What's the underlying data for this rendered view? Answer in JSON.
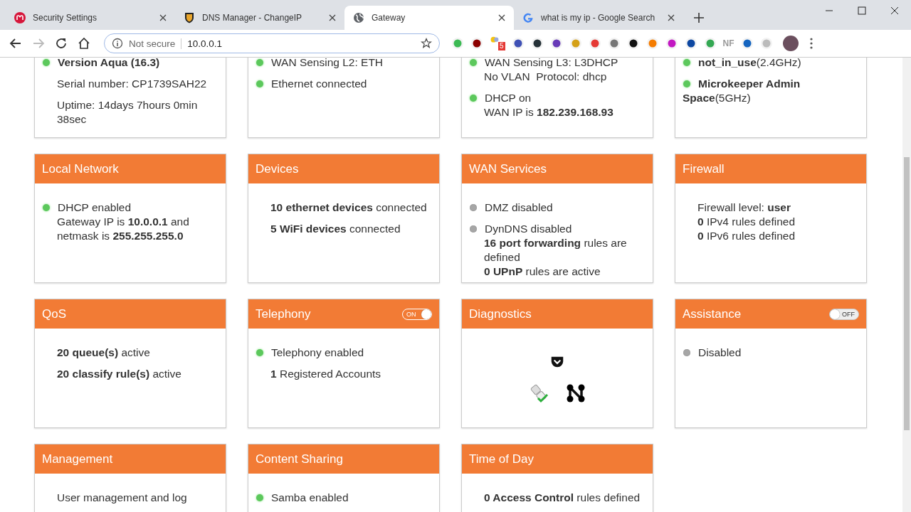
{
  "browser": {
    "tabs": [
      {
        "title": "Security Settings",
        "kind": "mlogo",
        "selected": false
      },
      {
        "title": "DNS Manager - ChangeIP",
        "kind": "shield",
        "selected": false
      },
      {
        "title": "Gateway",
        "kind": "globe",
        "selected": true
      },
      {
        "title": "what is my ip - Google Search",
        "kind": "google",
        "selected": false
      }
    ],
    "security_label": "Not secure",
    "url": "10.0.0.1",
    "extension_badge": "5",
    "extension_label": "NF"
  },
  "cards": [
    {
      "kind": "list",
      "items": [
        {
          "kind": "dot",
          "on": true,
          "bold": true,
          "lines": [
            "Version Aqua (16.3)"
          ]
        },
        {
          "kind": "plain",
          "lines": [
            "Serial number: CP1739SAH22"
          ]
        },
        {
          "kind": "plain",
          "lines": [
            "Uptime: 14days 7hours 0min 38sec"
          ]
        }
      ]
    },
    {
      "kind": "list",
      "items": [
        {
          "kind": "dot",
          "on": true,
          "lines": [
            "WAN Sensing L2: ETH"
          ]
        },
        {
          "kind": "dot",
          "on": true,
          "lines": [
            "Ethernet connected"
          ]
        }
      ]
    },
    {
      "kind": "list",
      "items": [
        {
          "kind": "dot",
          "on": true,
          "lines": [
            "WAN Sensing L3: L3DHCP",
            "No VLAN  Protocol: dhcp"
          ]
        },
        {
          "kind": "dot",
          "on": true,
          "lines": [
            "DHCP on",
            "WAN IP is **182.239.168.93**"
          ]
        }
      ]
    },
    {
      "kind": "list",
      "items": [
        {
          "kind": "dot",
          "on": true,
          "lines": [
            "**not_in_use**(2.4GHz)"
          ]
        },
        {
          "kind": "dot",
          "on": true,
          "lines": [
            "**Microkeeper Admin Space**(5GHz)"
          ]
        }
      ]
    },
    {
      "title": "Local Network",
      "kind": "list",
      "items": [
        {
          "kind": "dot",
          "on": true,
          "lines": [
            "DHCP enabled",
            "Gateway IP is **10.0.0.1** and netmask is **255.255.255.0**"
          ]
        }
      ]
    },
    {
      "title": "Devices",
      "kind": "list",
      "items": [
        {
          "kind": "plain",
          "lines": [
            "**10 ethernet devices** connected"
          ]
        },
        {
          "kind": "plain",
          "lines": [
            "**5 WiFi devices** connected"
          ]
        }
      ]
    },
    {
      "title": "WAN Services",
      "kind": "list",
      "items": [
        {
          "kind": "dot",
          "on": false,
          "lines": [
            "DMZ disabled"
          ]
        },
        {
          "kind": "dot",
          "on": false,
          "lines": [
            "DynDNS disabled",
            "**16 port forwarding** rules are defined",
            "**0 UPnP** rules are active"
          ]
        }
      ]
    },
    {
      "title": "Firewall",
      "kind": "list",
      "items": [
        {
          "kind": "plain",
          "lines": [
            "Firewall level: **user**",
            "**0** IPv4 rules defined",
            "**0** IPv6 rules defined"
          ]
        }
      ]
    },
    {
      "title": "QoS",
      "kind": "list",
      "items": [
        {
          "kind": "plain",
          "lines": [
            "**20 queue(s)** active"
          ]
        },
        {
          "kind": "plain",
          "lines": [
            "**20 classify rule(s)** active"
          ]
        }
      ]
    },
    {
      "title": "Telephony",
      "toggle": {
        "on": true,
        "label": "ON"
      },
      "kind": "list",
      "items": [
        {
          "kind": "dot",
          "on": true,
          "lines": [
            "Telephony enabled"
          ]
        },
        {
          "kind": "plain",
          "lines": [
            "**1** Registered Accounts"
          ]
        }
      ]
    },
    {
      "title": "Diagnostics",
      "kind": "icons"
    },
    {
      "title": "Assistance",
      "toggle": {
        "on": false,
        "label": "OFF"
      },
      "kind": "list",
      "items": [
        {
          "kind": "dot",
          "on": false,
          "lines": [
            "Disabled"
          ]
        }
      ]
    },
    {
      "title": "Management",
      "kind": "list",
      "items": [
        {
          "kind": "plain",
          "lines": [
            "User management and log"
          ]
        }
      ]
    },
    {
      "title": "Content Sharing",
      "kind": "list",
      "items": [
        {
          "kind": "dot",
          "on": true,
          "lines": [
            "Samba enabled"
          ]
        }
      ]
    },
    {
      "title": "Time of Day",
      "kind": "list",
      "items": [
        {
          "kind": "plain",
          "lines": [
            "**0 Access Control** rules defined"
          ]
        }
      ]
    }
  ]
}
